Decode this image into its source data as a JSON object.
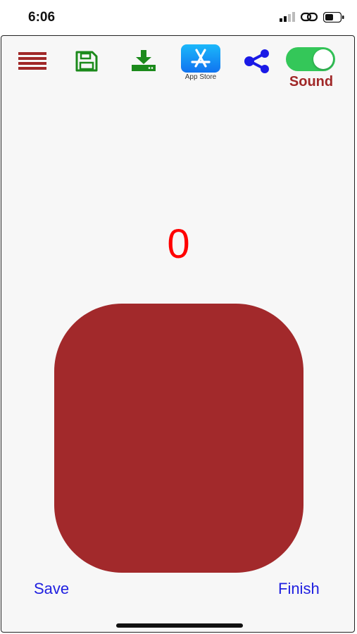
{
  "status_bar": {
    "time": "6:06",
    "icons": [
      "cellular-signal-icon",
      "link-icon",
      "battery-icon"
    ]
  },
  "toolbar": {
    "icons": [
      "menu-icon",
      "save-disk-icon",
      "download-icon",
      "app-store-icon",
      "share-icon"
    ],
    "app_store_label": "App Store",
    "sound_label": "Sound",
    "sound_on": true,
    "colors": {
      "menu": "#a02828",
      "save": "#1c8a1c",
      "download": "#1c8a1c",
      "share": "#1a1ae6",
      "toggle": "#34c759"
    }
  },
  "main": {
    "counter": "0",
    "counter_color": "#ff0000",
    "button_color": "#a2292b"
  },
  "footer": {
    "save_label": "Save",
    "finish_label": "Finish",
    "link_color": "#2020e0"
  }
}
